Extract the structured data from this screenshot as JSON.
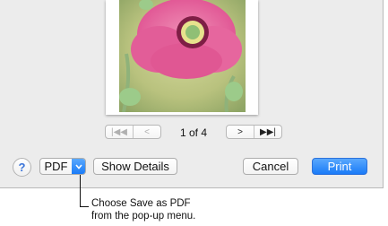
{
  "pager": {
    "first_icon": "first-page-icon",
    "prev_icon": "prev-page-icon",
    "next_icon": "next-page-icon",
    "last_icon": "last-page-icon",
    "indicator": "1 of 4"
  },
  "buttons": {
    "help_label": "?",
    "pdf_label": "PDF",
    "show_details_label": "Show Details",
    "cancel_label": "Cancel",
    "print_label": "Print"
  },
  "callout": {
    "line1": "Choose Save as PDF",
    "line2": "from the pop-up menu."
  },
  "colors": {
    "accent": "#1a7bf7",
    "dialog_bg": "#ececec"
  }
}
